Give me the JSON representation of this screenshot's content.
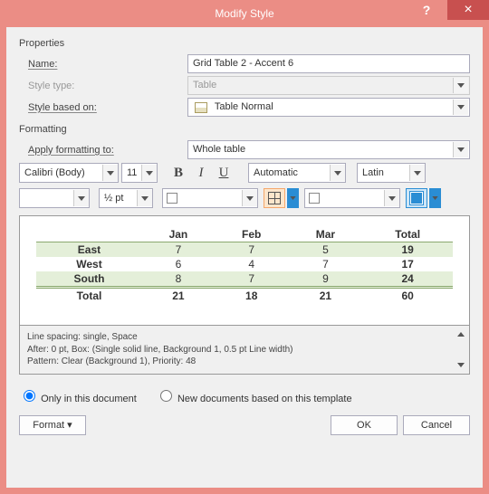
{
  "title": "Modify Style",
  "help": "?",
  "close": "×",
  "sect_properties": "Properties",
  "sect_formatting": "Formatting",
  "labels": {
    "name": "Name:",
    "style_type": "Style type:",
    "based_on": "Style based on:",
    "apply_to": "Apply formatting to:"
  },
  "values": {
    "name": "Grid Table 2 - Accent 6",
    "style_type": "Table",
    "based_on": "Table Normal",
    "apply_to": "Whole table",
    "font": "Calibri (Body)",
    "size": "11",
    "color": "Automatic",
    "script": "Latin",
    "line_weight": "½ pt"
  },
  "table": {
    "headers": [
      "",
      "Jan",
      "Feb",
      "Mar",
      "Total"
    ],
    "rows": [
      [
        "East",
        "7",
        "7",
        "5",
        "19"
      ],
      [
        "West",
        "6",
        "4",
        "7",
        "17"
      ],
      [
        "South",
        "8",
        "7",
        "9",
        "24"
      ],
      [
        "Total",
        "21",
        "18",
        "21",
        "60"
      ]
    ]
  },
  "desc": {
    "l1": "Line spacing:  single, Space",
    "l2": "After:  0 pt, Box: (Single solid line, Background 1,  0.5 pt Line width)",
    "l3": "Pattern: Clear (Background 1), Priority: 48"
  },
  "radio": {
    "only": "Only in this document",
    "newdocs": "New documents based on this template"
  },
  "buttons": {
    "format": "Format ▾",
    "ok": "OK",
    "cancel": "Cancel"
  }
}
